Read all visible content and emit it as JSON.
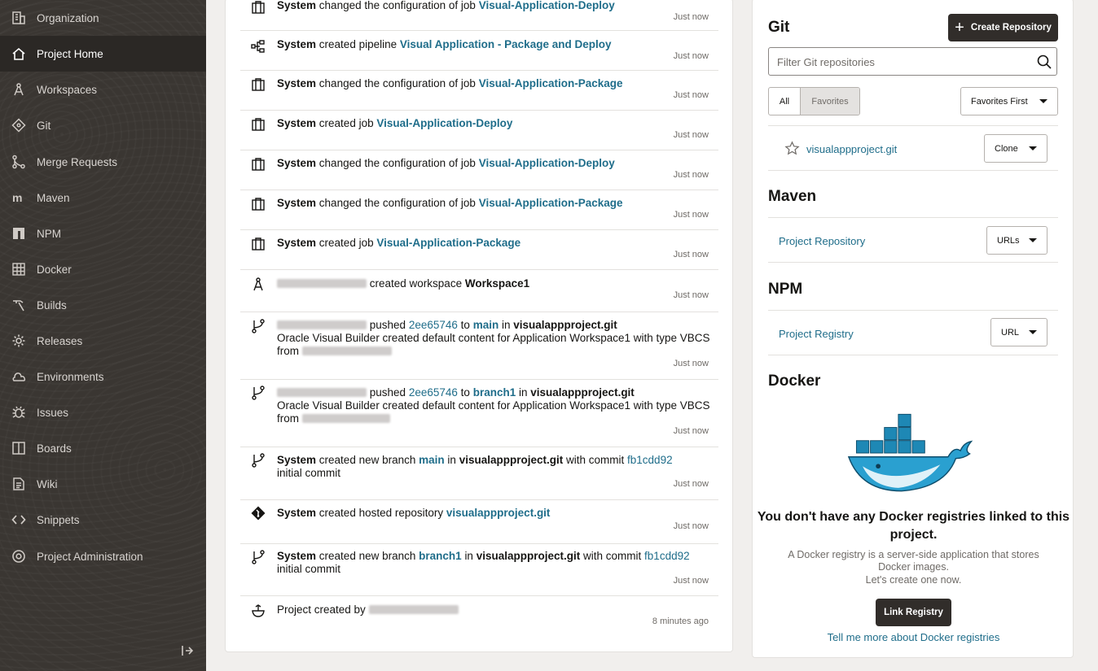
{
  "sidebar": {
    "items": [
      {
        "label": "Organization",
        "icon": "building-icon"
      },
      {
        "label": "Project Home",
        "icon": "home-icon",
        "active": true
      },
      {
        "label": "Workspaces",
        "icon": "compass-icon"
      },
      {
        "label": "Git",
        "icon": "git-icon"
      },
      {
        "label": "Merge Requests",
        "icon": "merge-icon"
      },
      {
        "label": "Maven",
        "icon": "maven-icon"
      },
      {
        "label": "NPM",
        "icon": "npm-icon"
      },
      {
        "label": "Docker",
        "icon": "docker-icon"
      },
      {
        "label": "Builds",
        "icon": "hammer-icon"
      },
      {
        "label": "Releases",
        "icon": "gear-icon"
      },
      {
        "label": "Environments",
        "icon": "cloud-icon"
      },
      {
        "label": "Issues",
        "icon": "bug-icon"
      },
      {
        "label": "Boards",
        "icon": "board-icon"
      },
      {
        "label": "Wiki",
        "icon": "document-icon"
      },
      {
        "label": "Snippets",
        "icon": "code-icon"
      },
      {
        "label": "Project Administration",
        "icon": "settings-icon"
      }
    ]
  },
  "feed": {
    "items": [
      {
        "icon": "job-icon",
        "actor": "System",
        "t1": "changed the configuration of job",
        "l1": "Visual-Application-Deploy",
        "time": "Just now"
      },
      {
        "icon": "pipeline-icon",
        "actor": "System",
        "t1": "created pipeline",
        "l1": "Visual Application - Package and Deploy",
        "time": "Just now"
      },
      {
        "icon": "job-icon",
        "actor": "System",
        "t1": "changed the configuration of job",
        "l1": "Visual-Application-Package",
        "time": "Just now"
      },
      {
        "icon": "job-icon",
        "actor": "System",
        "t1": "created job",
        "l1": "Visual-Application-Deploy",
        "time": "Just now"
      },
      {
        "icon": "job-icon",
        "actor": "System",
        "t1": "changed the configuration of job",
        "l1": "Visual-Application-Deploy",
        "time": "Just now"
      },
      {
        "icon": "job-icon",
        "actor": "System",
        "t1": "changed the configuration of job",
        "l1": "Visual-Application-Package",
        "time": "Just now"
      },
      {
        "icon": "job-icon",
        "actor": "System",
        "t1": "created job",
        "l1": "Visual-Application-Package",
        "time": "Just now"
      },
      {
        "icon": "workspace-icon",
        "t1": "created workspace",
        "b1": "Workspace1",
        "time": "Just now"
      },
      {
        "icon": "branch-icon",
        "t1": "pushed",
        "l1": "2ee65746",
        "t2": "to",
        "l2": "main",
        "t3": "in",
        "b1": "visualappproject.git",
        "line2": "Oracle Visual Builder created default content for Application Workspace1 with type VBCS",
        "line3": "from",
        "time": "Just now"
      },
      {
        "icon": "branch-icon",
        "t1": "pushed",
        "l1": "2ee65746",
        "t2": "to",
        "l2": "branch1",
        "t3": "in",
        "b1": "visualappproject.git",
        "line2": "Oracle Visual Builder created default content for Application Workspace1 with type VBCS",
        "line3": "from",
        "time": "Just now"
      },
      {
        "icon": "branch-icon",
        "actor": "System",
        "t1": "created new branch",
        "l1": "main",
        "t2": "in",
        "b1": "visualappproject.git",
        "t3": "with commit",
        "l2": "fb1cdd92",
        "line2": "initial commit",
        "time": "Just now"
      },
      {
        "icon": "git-repo-icon",
        "actor": "System",
        "t1": "created hosted repository",
        "l1": "visualappproject.git",
        "time": "Just now"
      },
      {
        "icon": "branch-icon",
        "actor": "System",
        "t1": "created new branch",
        "l1": "branch1",
        "t2": "in",
        "b1": "visualappproject.git",
        "t3": "with commit",
        "l2": "fb1cdd92",
        "line2": "initial commit",
        "time": "Just now"
      },
      {
        "icon": "project-icon",
        "t1": "Project created by",
        "time": "8 minutes ago"
      }
    ]
  },
  "git": {
    "title": "Git",
    "create_label": "Create Repository",
    "filter_placeholder": "Filter Git repositories",
    "tab_all": "All",
    "tab_favorites": "Favorites",
    "sort_label": "Favorites First",
    "repo_name": "visualappproject.git",
    "clone_label": "Clone"
  },
  "maven": {
    "title": "Maven",
    "link": "Project Repository",
    "menu_label": "URLs"
  },
  "npm": {
    "title": "NPM",
    "link": "Project Registry",
    "menu_label": "URL"
  },
  "docker": {
    "title": "Docker",
    "empty_title": "You don't have any Docker registries linked to this project.",
    "empty_desc": "A Docker registry is a server-side application that stores Docker images.",
    "empty_desc2": "Let's create one now.",
    "link_button": "Link Registry",
    "learn_more": "Tell me more about Docker registries"
  }
}
